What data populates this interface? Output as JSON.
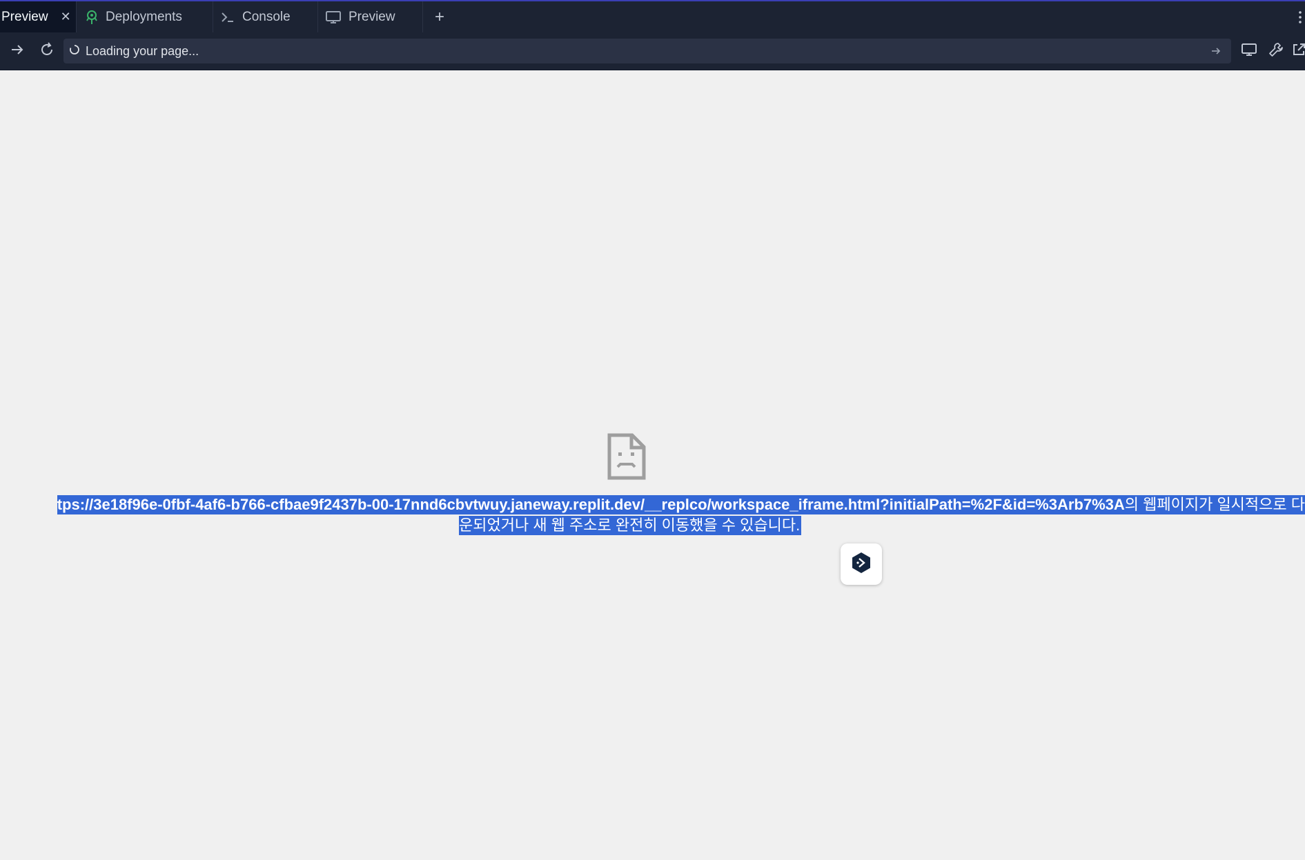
{
  "tabs": [
    {
      "label": "Preview",
      "active": true,
      "closable": true,
      "icon": "none"
    },
    {
      "label": "Deployments",
      "active": false,
      "icon": "deployments-icon"
    },
    {
      "label": "Console",
      "active": false,
      "icon": "terminal-icon"
    },
    {
      "label": "Preview",
      "active": false,
      "icon": "monitor-icon"
    }
  ],
  "tab_add_label": "+",
  "toolbar": {
    "status_text": "Loading your page..."
  },
  "error": {
    "url": "tps://3e18f96e-0fbf-4af6-b766-cfbae9f2437b-00-17nnd6cbvtwuy.janeway.replit.dev/__replco/workspace_iframe.html?initialPath=%2F&id=%3Arb7%3A",
    "line1_suffix": "의 웹페이지가 일시적으로 다",
    "line2": "운되었거나 새 웹 주소로 완전히 이동했을 수 있습니다."
  },
  "colors": {
    "tabbar_bg": "#1c2333",
    "active_tab_bg": "#0e1525",
    "urlbar_bg": "#2b3245",
    "content_bg": "#f0f0f0",
    "selection": "#3367d6",
    "accent_green": "#3ab36a"
  }
}
